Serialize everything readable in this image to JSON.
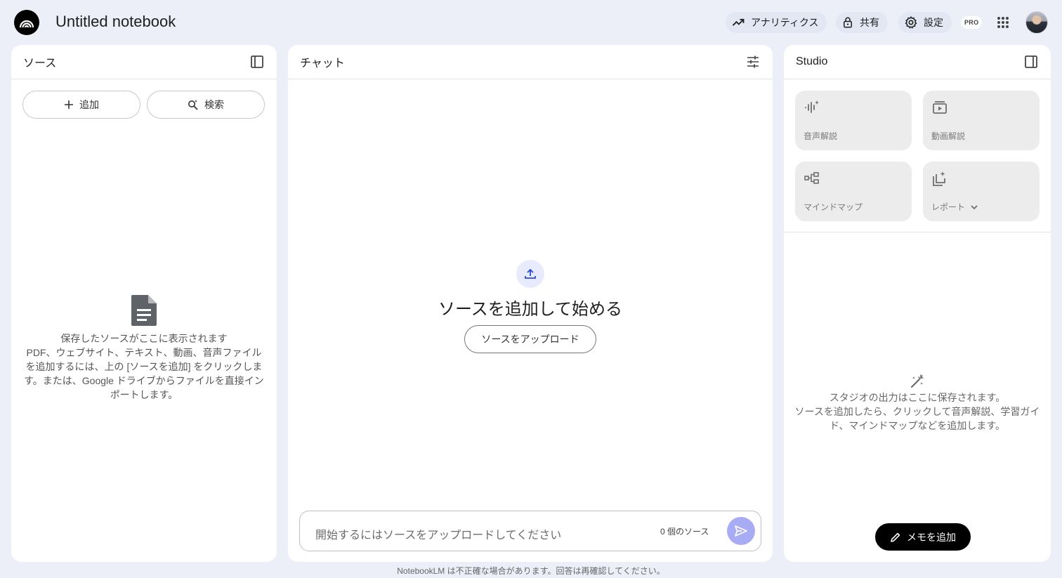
{
  "app": {
    "title": "Untitled notebook"
  },
  "header": {
    "analytics_label": "アナリティクス",
    "share_label": "共有",
    "settings_label": "設定",
    "pro_badge": "PRO"
  },
  "sources": {
    "title": "ソース",
    "add_label": "追加",
    "search_label": "検索",
    "empty_line1": "保存したソースがここに表示されます",
    "empty_line2": "PDF、ウェブサイト、テキスト、動画、音声ファイルを追加するには、上の [ソースを追加] をクリックします。または、Google ドライブからファイルを直接インポートします。"
  },
  "chat": {
    "title": "チャット",
    "headline": "ソースを追加して始める",
    "upload_label": "ソースをアップロード",
    "input_placeholder": "開始するにはソースをアップロードしてください",
    "source_count": "0 個のソース"
  },
  "studio": {
    "title": "Studio",
    "tiles": [
      {
        "label": "音声解説",
        "icon": "audio-sparkle-icon"
      },
      {
        "label": "動画解説",
        "icon": "video-icon"
      },
      {
        "label": "マインドマップ",
        "icon": "mind-map-icon"
      },
      {
        "label": "レポート",
        "icon": "report-icon"
      }
    ],
    "empty_line1": "スタジオの出力はここに保存されます。",
    "empty_line2": "ソースを追加したら、クリックして音声解説、学習ガイド、マインドマップなどを追加します。",
    "memo_label": "メモを追加"
  },
  "footer": {
    "text": "NotebookLM は不正確な場合があります。回答は再確認してください。"
  },
  "colors": {
    "background": "#eceef8",
    "accent": "#a8acf5",
    "upload_icon": "#2b4bd9"
  }
}
